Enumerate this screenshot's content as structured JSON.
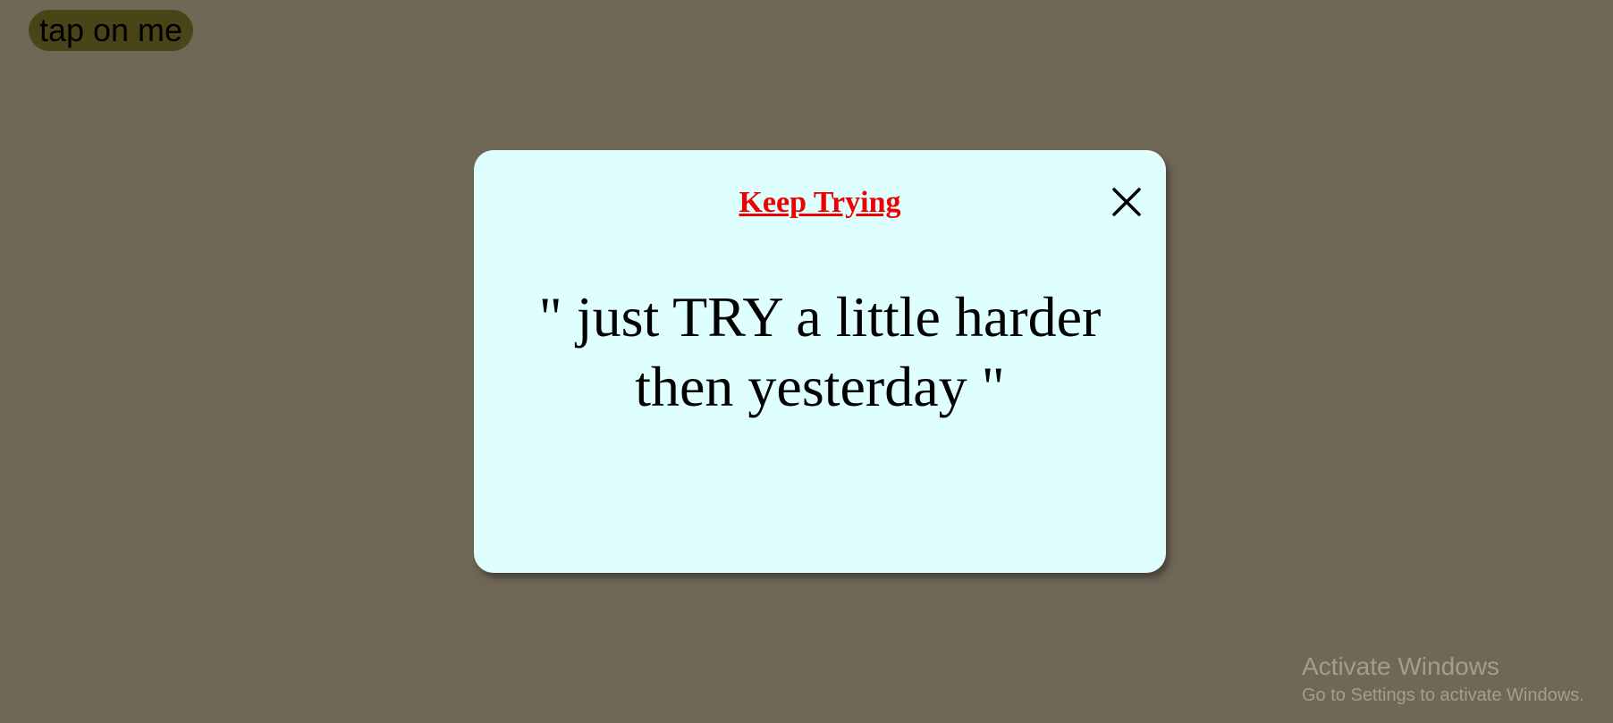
{
  "tap_button": {
    "label": "tap on me"
  },
  "modal": {
    "title": "Keep Trying",
    "quote": "\" just TRY a little harder then yesterday \"",
    "close_icon": "close-icon"
  },
  "watermark": {
    "title": "Activate Windows",
    "subtitle": "Go to Settings to activate Windows."
  },
  "colors": {
    "background": "#706857",
    "button": "#4a4518",
    "modal": "#dffffe",
    "title": "#ee0000"
  }
}
